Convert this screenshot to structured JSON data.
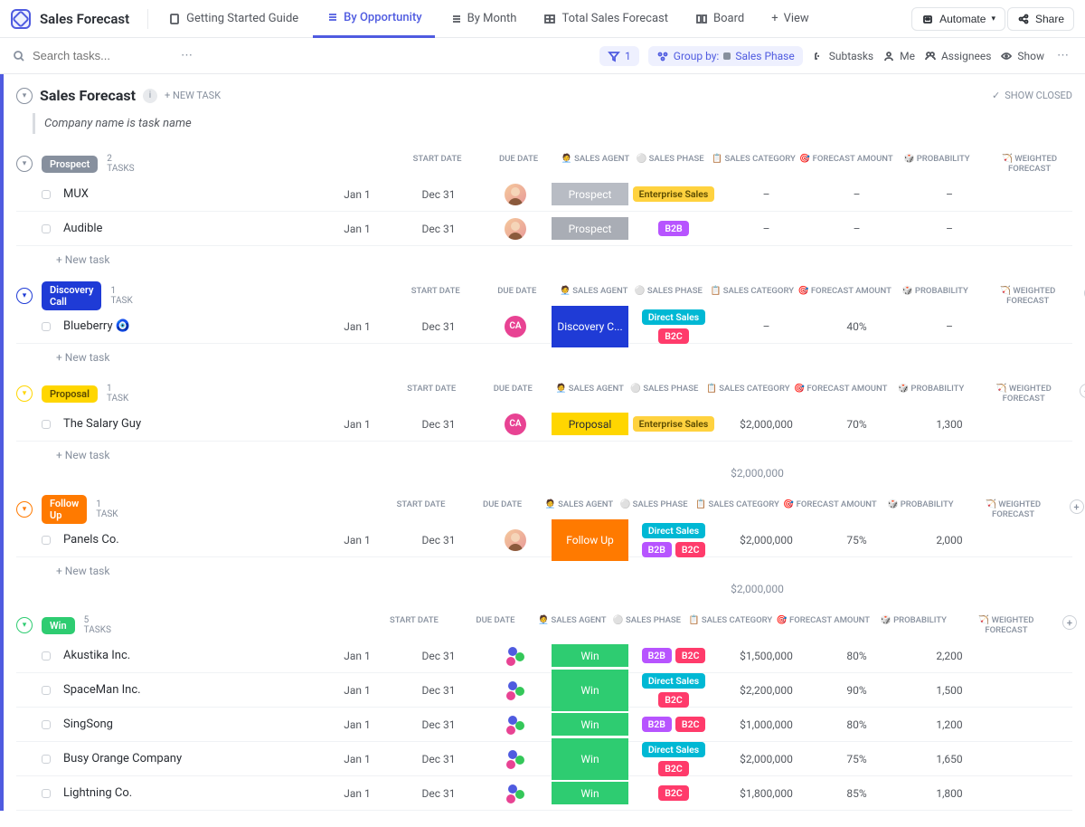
{
  "header": {
    "title": "Sales Forecast",
    "tabs": [
      {
        "label": "Getting Started Guide"
      },
      {
        "label": "By Opportunity"
      },
      {
        "label": "By Month"
      },
      {
        "label": "Total Sales Forecast"
      },
      {
        "label": "Board"
      },
      {
        "label": "View"
      }
    ],
    "automate": "Automate",
    "share": "Share"
  },
  "toolbar": {
    "search_placeholder": "Search tasks...",
    "filter_count": "1",
    "group_by_label": "Group by:",
    "group_by_value": "Sales Phase",
    "subtasks": "Subtasks",
    "me": "Me",
    "assignees": "Assignees",
    "show": "Show"
  },
  "list": {
    "title": "Sales Forecast",
    "new_task": "+ NEW TASK",
    "show_closed": "SHOW CLOSED",
    "hint": "Company name is task name"
  },
  "columns": [
    "START DATE",
    "DUE DATE",
    "🧑‍💼 SALES AGENT",
    "⚪ SALES PHASE",
    "📋 SALES CATEGORY",
    "🎯 FORECAST AMOUNT",
    "🎲 PROBABILITY",
    "🏹 WEIGHTED FORECAST"
  ],
  "add_task": "+ New task",
  "groups": [
    {
      "name": "Prospect",
      "color": "#87909e",
      "count": "2 TASKS",
      "rows": [
        {
          "name": "MUX",
          "start": "Jan 1",
          "due": "Dec 31",
          "agent": "img",
          "phase": "Prospect",
          "phase_bg": "#b8bcc4",
          "cats": [
            "enterprise"
          ],
          "forecast": "–",
          "prob": "–",
          "weighted": "–"
        },
        {
          "name": "Audible",
          "start": "Jan 1",
          "due": "Dec 31",
          "agent": "img",
          "phase": "Prospect",
          "phase_bg": "#a9adb5",
          "cats": [
            "b2b"
          ],
          "forecast": "–",
          "prob": "–",
          "weighted": "–"
        }
      ]
    },
    {
      "name": "Discovery Call",
      "color": "#1f3bd6",
      "count": "1 TASK",
      "rows": [
        {
          "name": "Blueberry 🧿",
          "start": "Jan 1",
          "due": "Dec 31",
          "agent": "ca",
          "phase": "Discovery C...",
          "phase_bg": "#1f3bd6",
          "cats": [
            "direct",
            "b2c"
          ],
          "forecast": "–",
          "prob": "40%",
          "weighted": "–"
        }
      ]
    },
    {
      "name": "Proposal",
      "color": "#ffd600",
      "text": "#5a4a00",
      "count": "1 TASK",
      "rows": [
        {
          "name": "The Salary Guy",
          "start": "Jan 1",
          "due": "Dec 31",
          "agent": "ca",
          "phase": "Proposal",
          "phase_bg": "#ffd600",
          "phase_fg": "#2a2e34",
          "cats": [
            "enterprise"
          ],
          "forecast": "$2,000,000",
          "prob": "70%",
          "weighted": "1,300"
        }
      ],
      "sum": "$2,000,000"
    },
    {
      "name": "Follow Up",
      "color": "#ff7a00",
      "count": "1 TASK",
      "rows": [
        {
          "name": "Panels Co.",
          "start": "Jan 1",
          "due": "Dec 31",
          "agent": "img",
          "phase": "Follow Up",
          "phase_bg": "#ff7a00",
          "cats": [
            "direct",
            "b2b",
            "b2c"
          ],
          "forecast": "$2,000,000",
          "prob": "75%",
          "weighted": "2,000"
        }
      ],
      "sum": "$2,000,000"
    },
    {
      "name": "Win",
      "color": "#2ecc71",
      "count": "5 TASKS",
      "rows": [
        {
          "name": "Akustika Inc.",
          "start": "Jan 1",
          "due": "Dec 31",
          "agent": "multi",
          "phase": "Win",
          "phase_bg": "#2ecc71",
          "cats": [
            "b2b",
            "b2c"
          ],
          "forecast": "$1,500,000",
          "prob": "80%",
          "weighted": "2,200"
        },
        {
          "name": "SpaceMan Inc.",
          "start": "Jan 1",
          "due": "Dec 31",
          "agent": "multi",
          "phase": "Win",
          "phase_bg": "#2ecc71",
          "cats": [
            "direct",
            "b2c"
          ],
          "forecast": "$2,200,000",
          "prob": "90%",
          "weighted": "1,500"
        },
        {
          "name": "SingSong",
          "start": "Jan 1",
          "due": "Dec 31",
          "agent": "multi",
          "phase": "Win",
          "phase_bg": "#2ecc71",
          "cats": [
            "b2b",
            "b2c"
          ],
          "forecast": "$1,000,000",
          "prob": "80%",
          "weighted": "1,200"
        },
        {
          "name": "Busy Orange Company",
          "start": "Jan 1",
          "due": "Dec 31",
          "agent": "multi",
          "phase": "Win",
          "phase_bg": "#2ecc71",
          "cats": [
            "direct",
            "b2c"
          ],
          "forecast": "$2,000,000",
          "prob": "75%",
          "weighted": "1,650"
        },
        {
          "name": "Lightning Co.",
          "start": "Jan 1",
          "due": "Dec 31",
          "agent": "multi",
          "phase": "Win",
          "phase_bg": "#2ecc71",
          "cats": [
            "b2c"
          ],
          "forecast": "$1,800,000",
          "prob": "85%",
          "weighted": "1,800"
        }
      ]
    }
  ],
  "cat_labels": {
    "enterprise": "Enterprise Sales",
    "b2b": "B2B",
    "b2c": "B2C",
    "direct": "Direct Sales"
  }
}
